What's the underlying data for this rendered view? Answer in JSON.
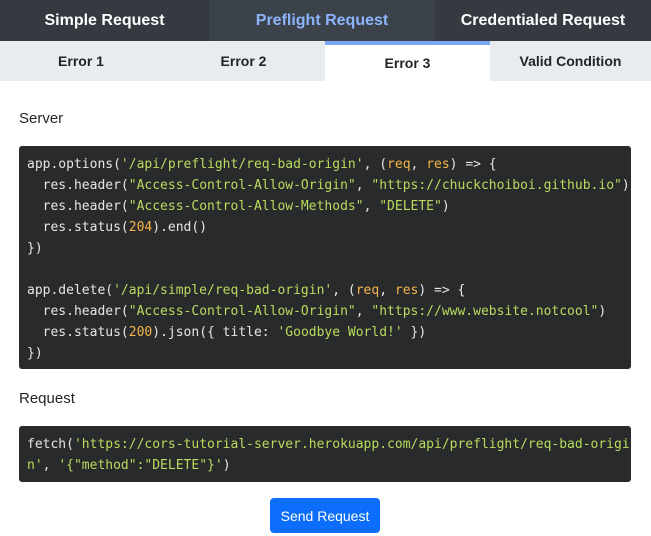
{
  "top_tabs": [
    {
      "label": "Simple Request",
      "active": false
    },
    {
      "label": "Preflight Request",
      "active": true
    },
    {
      "label": "Credentialed Request",
      "active": false
    }
  ],
  "sub_tabs": [
    {
      "label": "Error 1",
      "active": false
    },
    {
      "label": "Error 2",
      "active": false
    },
    {
      "label": "Error 3",
      "active": true
    },
    {
      "label": "Valid Condition",
      "active": false
    }
  ],
  "server": {
    "label": "Server",
    "code": {
      "l1_a": "app.options(",
      "l1_b": "'/api/preflight/req-bad-origin'",
      "l1_c": ", (",
      "l1_d": "req",
      "l1_e": ", ",
      "l1_f": "res",
      "l1_g": ") => {",
      "l2_a": "  res.header(",
      "l2_b": "\"Access-Control-Allow-Origin\"",
      "l2_c": ", ",
      "l2_d": "\"https://chuckchoiboi.github.io\"",
      "l2_e": ")",
      "l3_a": "  res.header(",
      "l3_b": "\"Access-Control-Allow-Methods\"",
      "l3_c": ", ",
      "l3_d": "\"DELETE\"",
      "l3_e": ")",
      "l4_a": "  res.status(",
      "l4_b": "204",
      "l4_c": ").end()",
      "l5": "})",
      "l7_a": "app.delete(",
      "l7_b": "'/api/simple/req-bad-origin'",
      "l7_c": ", (",
      "l7_d": "req",
      "l7_e": ", ",
      "l7_f": "res",
      "l7_g": ") => {",
      "l8_a": "  res.header(",
      "l8_b": "\"Access-Control-Allow-Origin\"",
      "l8_c": ", ",
      "l8_d": "\"https://www.website.notcool\"",
      "l8_e": ")",
      "l9_a": "  res.status(",
      "l9_b": "200",
      "l9_c": ").json({ title: ",
      "l9_d": "'Goodbye World!'",
      "l9_e": " })",
      "l10": "})"
    }
  },
  "request": {
    "label": "Request",
    "code": {
      "l1_a": "fetch(",
      "l1_b": "'https://cors-tutorial-server.herokuapp.com/api/preflight/req-bad-origi",
      "l2_a": "n'",
      "l2_b": ", ",
      "l2_c": "'{\"method\":\"DELETE\"}'",
      "l2_d": ")"
    }
  },
  "send_button": {
    "label": "Send Request"
  },
  "colors": {
    "nav_bg": "#343a40",
    "active_tab_text": "#8db4ff",
    "subtab_bg": "#e9ecef",
    "active_subtab_indicator": "#7aa7f7",
    "code_bg": "#282a2b",
    "code_string": "#b8dc5e",
    "code_param": "#f5b449",
    "button_bg": "#0d6efd"
  }
}
